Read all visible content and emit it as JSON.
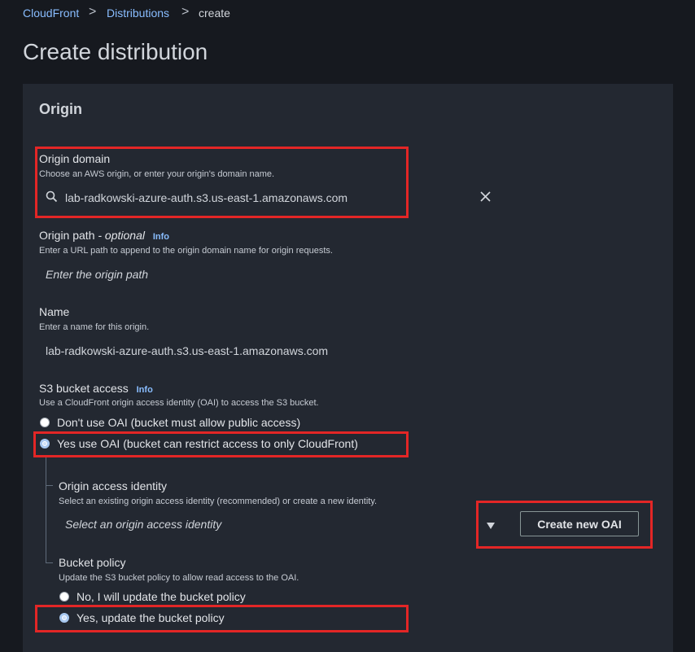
{
  "breadcrumb": {
    "items": [
      "CloudFront",
      "Distributions",
      "create"
    ],
    "separator": ">"
  },
  "page_title": "Create distribution",
  "panel": {
    "title": "Origin"
  },
  "origin_domain": {
    "label": "Origin domain",
    "description": "Choose an AWS origin, or enter your origin's domain name.",
    "value": "lab-radkowski-azure-auth.s3.us-east-1.amazonaws.com",
    "clear_icon": "close-icon",
    "search_icon": "search-icon"
  },
  "origin_path": {
    "label": "Origin path",
    "optional_label": "- optional",
    "info": "Info",
    "description": "Enter a URL path to append to the origin domain name for origin requests.",
    "placeholder": "Enter the origin path"
  },
  "name": {
    "label": "Name",
    "description": "Enter a name for this origin.",
    "value": "lab-radkowski-azure-auth.s3.us-east-1.amazonaws.com"
  },
  "s3_access": {
    "label": "S3 bucket access",
    "info": "Info",
    "description": "Use a CloudFront origin access identity (OAI) to access the S3 bucket.",
    "options": [
      "Don't use OAI (bucket must allow public access)",
      "Yes use OAI (bucket can restrict access to only CloudFront)"
    ],
    "selected": 1
  },
  "oai": {
    "label": "Origin access identity",
    "description": "Select an existing origin access identity (recommended) or create a new identity.",
    "placeholder": "Select an origin access identity",
    "dropdown_icon": "caret-down-icon",
    "create_button": "Create new OAI"
  },
  "bucket_policy": {
    "label": "Bucket policy",
    "description": "Update the S3 bucket policy to allow read access to the OAI.",
    "options": [
      "No, I will update the bucket policy",
      "Yes, update the bucket policy"
    ],
    "selected": 1
  },
  "colors": {
    "highlight": "#e32626",
    "link": "#89bdff",
    "background": "#16191f",
    "panel": "#232831"
  }
}
